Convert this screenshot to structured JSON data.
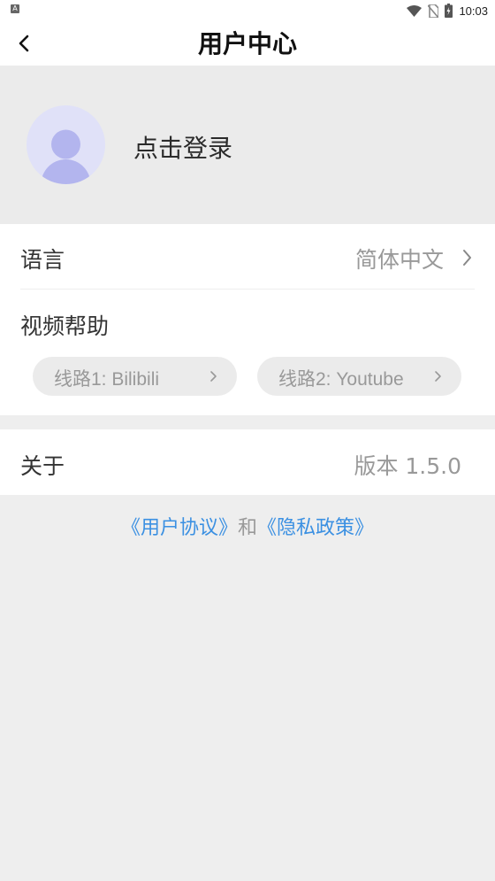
{
  "status_bar": {
    "left_icon": "A",
    "time": "10:03",
    "icons": [
      "wifi-icon",
      "no-sim-icon",
      "battery-charging-icon"
    ]
  },
  "header": {
    "title": "用户中心",
    "back_icon": "chevron-left-icon"
  },
  "profile": {
    "login_text": "点击登录",
    "avatar_icon": "user-avatar-icon"
  },
  "settings": {
    "language": {
      "label": "语言",
      "value": "简体中文"
    },
    "video_help": {
      "label": "视频帮助",
      "routes": [
        {
          "label": "线路1:  Bilibili"
        },
        {
          "label": "线路2: Youtube"
        }
      ]
    },
    "about": {
      "label": "关于",
      "version": "版本 1.5.0"
    }
  },
  "footer": {
    "user_agreement": "《用户协议》",
    "and": "和",
    "privacy_policy": "《隐私政策》"
  },
  "colors": {
    "background": "#eeeeee",
    "link": "#3b90e2",
    "avatar_bg": "#e0e1f8",
    "avatar_fg": "#b3b5ee"
  }
}
